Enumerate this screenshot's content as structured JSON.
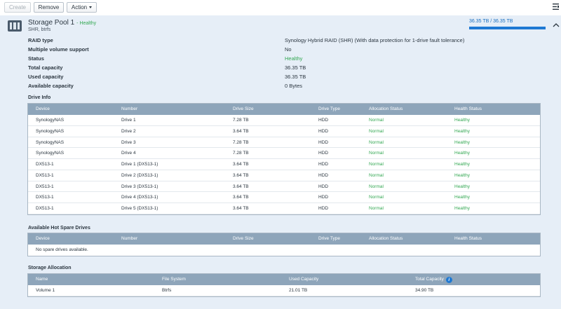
{
  "toolbar": {
    "create_label": "Create",
    "remove_label": "Remove",
    "action_label": "Action"
  },
  "pool": {
    "title": "Storage Pool 1",
    "health_suffix": "- Healthy",
    "subtitle": "SHR, btrfs",
    "capacity_text": "36.35 TB / 36.35 TB",
    "capacity_used_fraction": 1.0,
    "properties": [
      {
        "label": "RAID type",
        "value": "Synology Hybrid RAID (SHR) (With data protection for 1-drive fault tolerance)",
        "status": false
      },
      {
        "label": "Multiple volume support",
        "value": "No",
        "status": false
      },
      {
        "label": "Status",
        "value": "Healthy",
        "status": true
      },
      {
        "label": "Total capacity",
        "value": "36.35 TB",
        "status": false
      },
      {
        "label": "Used capacity",
        "value": "36.35 TB",
        "status": false
      },
      {
        "label": "Available capacity",
        "value": "0 Bytes",
        "status": false
      }
    ]
  },
  "drive_info": {
    "title": "Drive Info",
    "columns": [
      "Device",
      "Number",
      "Drive Size",
      "Drive Type",
      "Allocation Status",
      "Health Status"
    ],
    "rows": [
      [
        "SynologyNAS",
        "Drive 1",
        "7.28 TB",
        "HDD",
        "Normal",
        "Healthy"
      ],
      [
        "SynologyNAS",
        "Drive 2",
        "3.64 TB",
        "HDD",
        "Normal",
        "Healthy"
      ],
      [
        "SynologyNAS",
        "Drive 3",
        "7.28 TB",
        "HDD",
        "Normal",
        "Healthy"
      ],
      [
        "SynologyNAS",
        "Drive 4",
        "7.28 TB",
        "HDD",
        "Normal",
        "Healthy"
      ],
      [
        "DX513-1",
        "Drive 1 (DX513-1)",
        "3.64 TB",
        "HDD",
        "Normal",
        "Healthy"
      ],
      [
        "DX513-1",
        "Drive 2 (DX513-1)",
        "3.64 TB",
        "HDD",
        "Normal",
        "Healthy"
      ],
      [
        "DX513-1",
        "Drive 3 (DX513-1)",
        "3.64 TB",
        "HDD",
        "Normal",
        "Healthy"
      ],
      [
        "DX513-1",
        "Drive 4 (DX513-1)",
        "3.64 TB",
        "HDD",
        "Normal",
        "Healthy"
      ],
      [
        "DX513-1",
        "Drive 5 (DX513-1)",
        "3.64 TB",
        "HDD",
        "Normal",
        "Healthy"
      ]
    ]
  },
  "hot_spare": {
    "title": "Available Hot Spare Drives",
    "columns": [
      "Device",
      "Number",
      "Drive Size",
      "Drive Type",
      "Allocation Status",
      "Health Status"
    ],
    "empty_text": "No spare drives available."
  },
  "storage_allocation": {
    "title": "Storage Allocation",
    "columns": [
      "Name",
      "File System",
      "Used Capacity",
      "Total Capacity"
    ],
    "rows": [
      [
        "Volume 1",
        "Btrfs",
        "21.01 TB",
        "34.90 TB"
      ]
    ]
  },
  "colors": {
    "healthy": "#34a853",
    "header_bg": "#8ea5ba",
    "panel_bg": "#e6eef7",
    "accent": "#1f79d3"
  }
}
